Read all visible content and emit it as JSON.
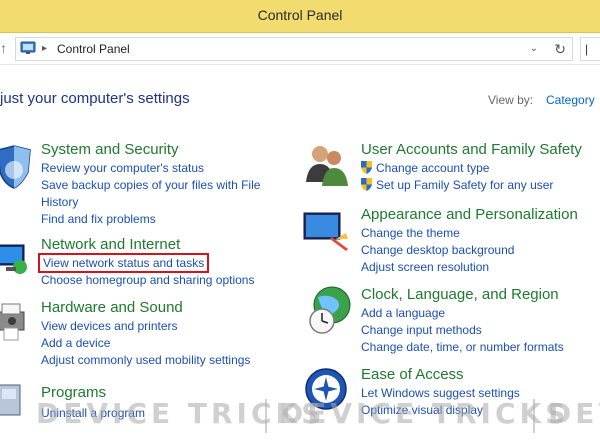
{
  "window": {
    "title": "Control Panel"
  },
  "address_bar": {
    "path": "Control Panel"
  },
  "header": {
    "title": "just your computer's settings",
    "view_by_label": "View by:",
    "view_by_value": "Category"
  },
  "left_categories": [
    {
      "title": "System and Security",
      "links": [
        "Review your computer's status",
        "Save backup copies of your files with File History",
        "Find and fix problems"
      ]
    },
    {
      "title": "Network and Internet",
      "links": [
        "View network status and tasks",
        "Choose homegroup and sharing options"
      ]
    },
    {
      "title": "Hardware and Sound",
      "links": [
        "View devices and printers",
        "Add a device",
        "Adjust commonly used mobility settings"
      ]
    },
    {
      "title": "Programs",
      "links": [
        "Uninstall a program"
      ]
    }
  ],
  "right_categories": [
    {
      "title": "User Accounts and Family Safety",
      "links": [
        "Change account type",
        "Set up Family Safety for any user"
      ]
    },
    {
      "title": "Appearance and Personalization",
      "links": [
        "Change the theme",
        "Change desktop background",
        "Adjust screen resolution"
      ]
    },
    {
      "title": "Clock, Language, and Region",
      "links": [
        "Add a language",
        "Change input methods",
        "Change date, time, or number formats"
      ]
    },
    {
      "title": "Ease of Access",
      "links": [
        "Let Windows suggest settings",
        "Optimize visual display"
      ]
    }
  ],
  "watermark": {
    "text": "DEVICE TRICKS"
  },
  "colors": {
    "title_bar": "#f2dc6f",
    "category_title": "#1e7a2e",
    "link": "#1a4fb3",
    "highlight": "#d0151d"
  }
}
